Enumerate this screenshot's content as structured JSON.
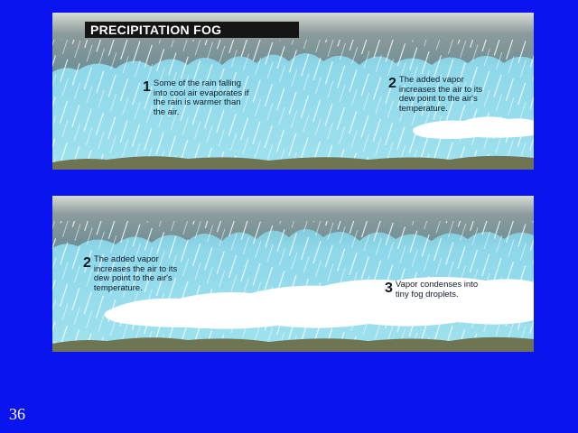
{
  "title": "PRECIPITATION FOG",
  "panels": {
    "top": {
      "callouts": [
        {
          "number": "1",
          "text": "Some of the rain falling\ninto cool air evaporates if\nthe rain is warmer than\nthe air."
        },
        {
          "number": "2",
          "text": "The added vapor\nincreases the air to its\ndew point to the air's\ntemperature."
        }
      ]
    },
    "bottom": {
      "callouts": [
        {
          "number": "2",
          "text": "The added vapor\nincreases the air to its\ndew point to the air's\ntemperature."
        },
        {
          "number": "3",
          "text": "Vapor condenses into\ntiny fog droplets."
        }
      ]
    }
  },
  "slide_number": "36",
  "colors": {
    "slide_background": "#0a14f0",
    "sky": "#88d7e8",
    "cloud": "#8c9b9b",
    "fog": "#ffffff",
    "ground": "#6f7552",
    "banner": "#141414"
  }
}
